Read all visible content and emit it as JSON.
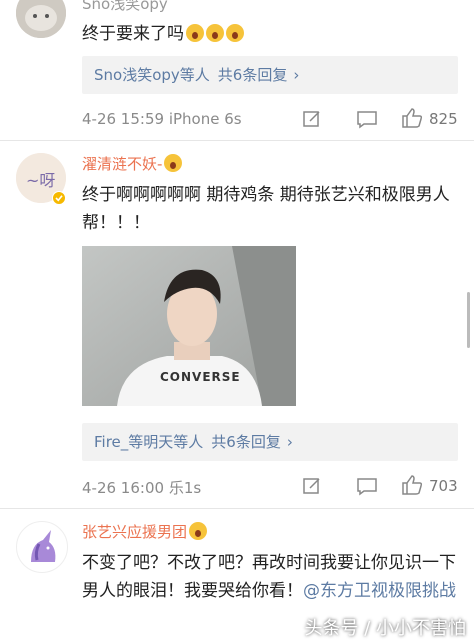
{
  "comments": [
    {
      "username": "Sno浅笑opy",
      "text": "终于要来了吗",
      "reply_who": "Sno浅笑opy等人",
      "reply_count": "共6条回复",
      "reply_arrow": "›",
      "time": "4-26 15:59",
      "device": "iPhone 6s",
      "likes": "825"
    },
    {
      "username": "濯清涟不妖-",
      "text": "终于啊啊啊啊啊 期待鸡条 期待张艺兴和极限男人帮！！！",
      "reply_who": "Fire_等明天等人",
      "reply_count": "共6条回复",
      "reply_arrow": "›",
      "time": "4-26 16:00",
      "device": "乐1s",
      "likes": "703",
      "shirt_text": "CONVERSE"
    },
    {
      "username": "张艺兴应援男团",
      "text_main": "不变了吧？不改了吧？再改时间我要让你见识一下男人的眼泪！我要哭给你看！",
      "mention": "@东方卫视极限挑战"
    }
  ],
  "watermark": "头条号 / 小小不害怕",
  "colors": {
    "username": "#eb7350",
    "link": "#5d7ba3",
    "meta": "#8a8a8a",
    "reply_bg": "#f2f2f2"
  },
  "icons": [
    "edit-icon",
    "comment-icon",
    "like-icon",
    "verified-badge-icon",
    "unicorn-icon"
  ]
}
